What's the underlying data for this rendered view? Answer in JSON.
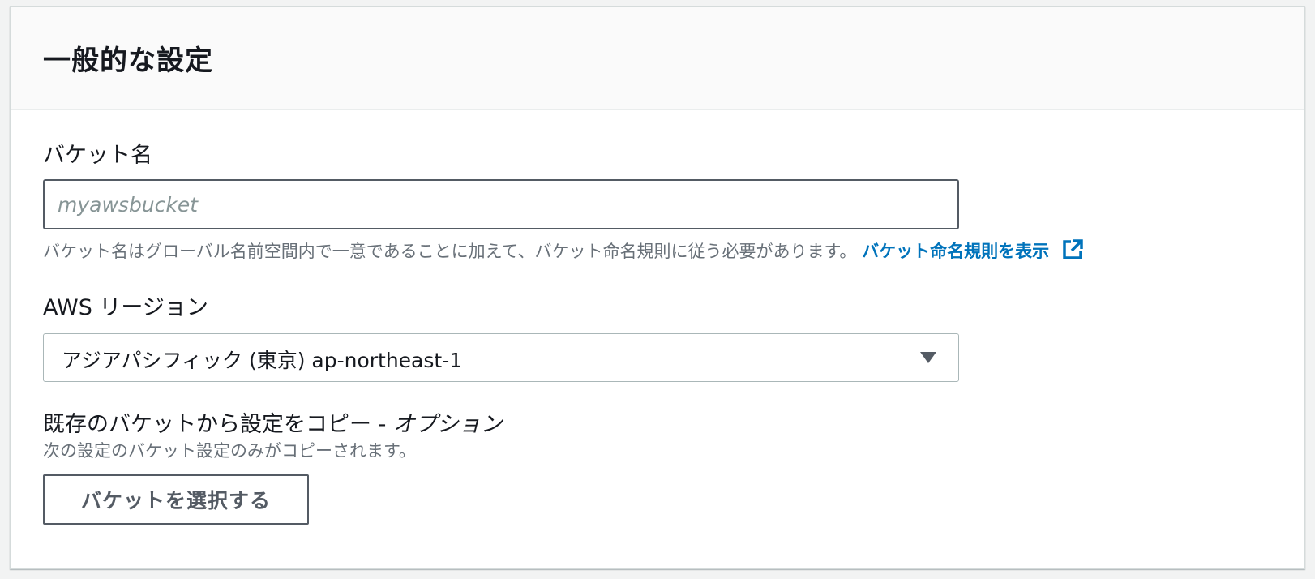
{
  "panel": {
    "title": "一般的な設定"
  },
  "bucket_name": {
    "label": "バケット名",
    "placeholder": "myawsbucket",
    "value": "",
    "hint": "バケット名はグローバル名前空間内で一意であることに加えて、バケット命名規則に従う必要があります。",
    "link_label": "バケット命名規則を表示",
    "link_icon": "external-link-icon"
  },
  "region": {
    "label": "AWS リージョン",
    "selected": "アジアパシフィック (東京) ap-northeast-1",
    "caret_icon": "caret-down-icon"
  },
  "copy_settings": {
    "label": "既存のバケットから設定をコピー - ",
    "label_optional": "オプション",
    "description": "次の設定のバケット設定のみがコピーされます。",
    "button_label": "バケットを選択する"
  },
  "colors": {
    "link": "#0073bb",
    "text": "#16191f",
    "muted": "#687078",
    "header_bg": "#fafafa",
    "page_bg": "#f2f3f3"
  }
}
